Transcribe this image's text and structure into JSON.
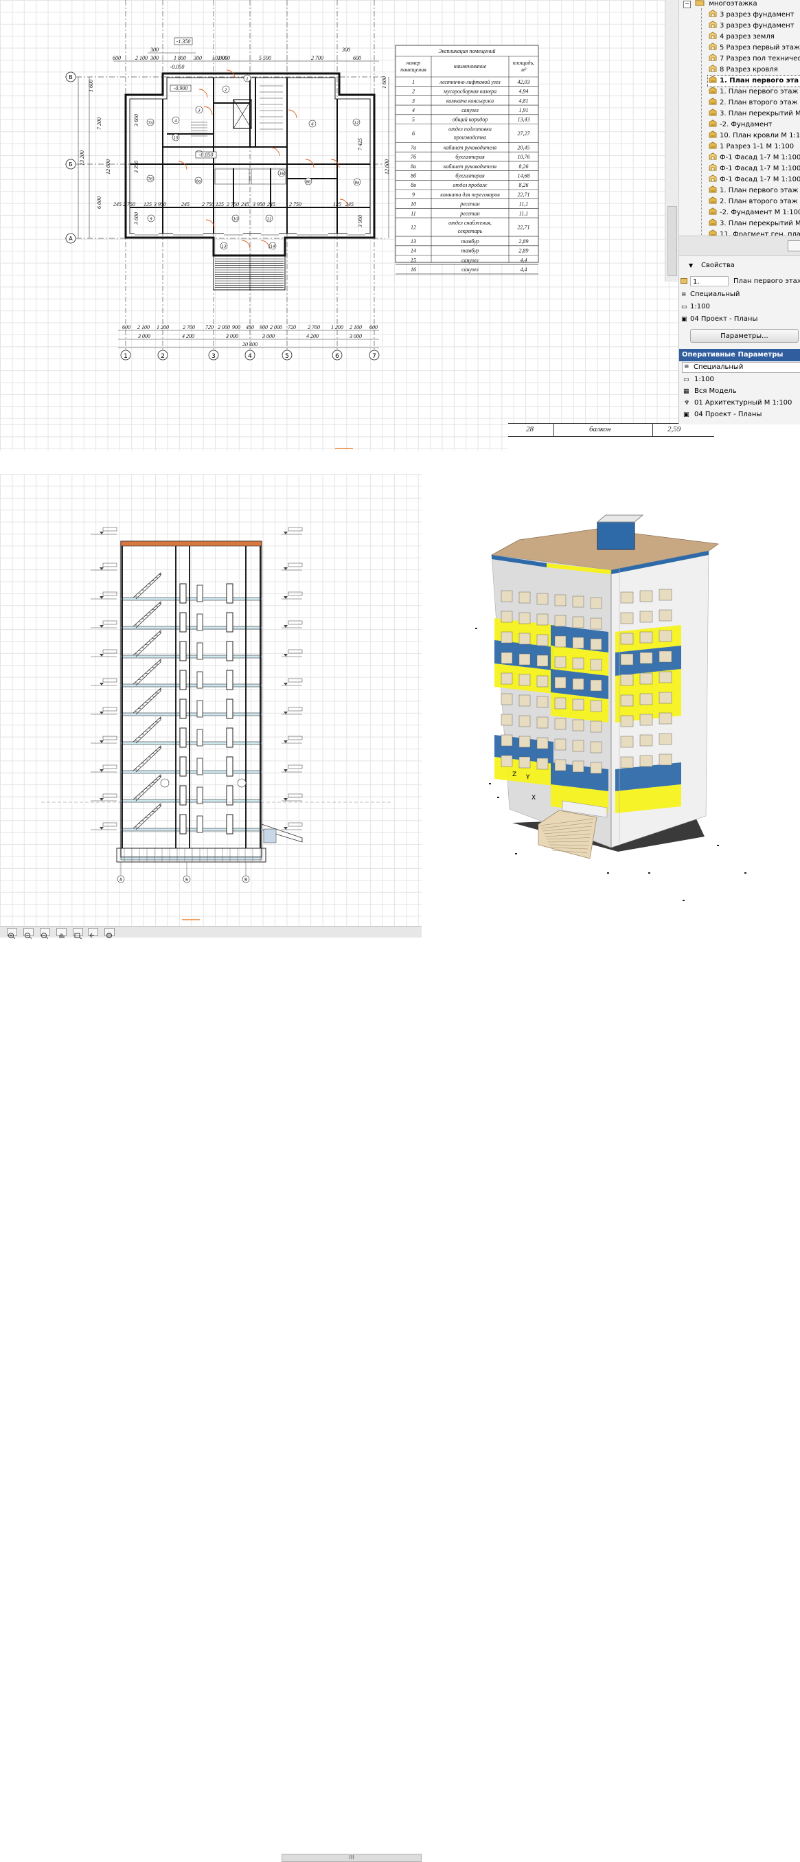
{
  "navigator": {
    "root_label": "многоэтажка",
    "items": [
      {
        "label": "3 разрез фундамент",
        "type": "section"
      },
      {
        "label": "3 разрез фундамент",
        "type": "section"
      },
      {
        "label": "4 разрез земля",
        "type": "section"
      },
      {
        "label": "5 Разрез первый этаж",
        "type": "section"
      },
      {
        "label": "7 Разрез пол техничес",
        "type": "section"
      },
      {
        "label": "8 Разрез кровля",
        "type": "section"
      },
      {
        "label": "1. План первого эта",
        "type": "layout",
        "selected": true
      },
      {
        "label": "1. План первого этаж",
        "type": "layout"
      },
      {
        "label": "2. План второго этаж",
        "type": "layout"
      },
      {
        "label": "3. План перекрытий М",
        "type": "layout"
      },
      {
        "label": "-2. Фундамент",
        "type": "layout"
      },
      {
        "label": "10. План кровли М 1:1",
        "type": "layout"
      },
      {
        "label": "1 Разрез 1-1 М 1:100",
        "type": "layout"
      },
      {
        "label": "Ф-1 Фасад 1-7 М 1:100",
        "type": "section"
      },
      {
        "label": "Ф-1 Фасад 1-7 М 1:100",
        "type": "section"
      },
      {
        "label": "Ф-1 Фасад 1-7 М 1:100",
        "type": "section"
      },
      {
        "label": "1. План первого этаж",
        "type": "layout"
      },
      {
        "label": "2. План второго этаж",
        "type": "layout"
      },
      {
        "label": "-2. Фундамент М 1:100",
        "type": "layout"
      },
      {
        "label": "3. План перекрытий М",
        "type": "layout"
      },
      {
        "label": "11. Фрагмент ген. пла",
        "type": "layout"
      }
    ]
  },
  "properties": {
    "title": "Свойства",
    "id_value": "1.",
    "name_value": "План первого этаж",
    "layer_combo": "Специальный",
    "scale": "1:100",
    "pen_set": "04 Проект - Планы",
    "settings_button": "Параметры..."
  },
  "quick_options": {
    "title": "Оперативные Параметры",
    "layer_combo": "Специальный",
    "scale": "1:100",
    "model_view": "Вся Модель",
    "structure": "01 Архитектурный М 1:100",
    "pen_set": "04 Проект - Планы"
  },
  "strip_row": {
    "num": "28",
    "name": "балкон",
    "area": "2,59"
  },
  "explication": {
    "title": "Экспликация помещений",
    "headers": [
      "номер помещения",
      "наименование",
      "площадь, м^2"
    ],
    "rows": [
      [
        "1",
        "лестнично-лифтовой узел",
        "42,03"
      ],
      [
        "2",
        "мусоросборная камера",
        "4,94"
      ],
      [
        "3",
        "комната консьержа",
        "4,81"
      ],
      [
        "4",
        "санузел",
        "1,91"
      ],
      [
        "5",
        "общий коридор",
        "13,43"
      ],
      [
        "6",
        "отдел подготовки производства",
        "27,27"
      ],
      [
        "7а",
        "кабинет руководителя",
        "20,45"
      ],
      [
        "7б",
        "бухгалтерия",
        "10,76"
      ],
      [
        "8а",
        "кабинет руководителя",
        "8,26"
      ],
      [
        "8б",
        "бухгалтерия",
        "14,68"
      ],
      [
        "8в",
        "отдел продаж",
        "8,26"
      ],
      [
        "9",
        "комната для переговоров",
        "22,71"
      ],
      [
        "10",
        "ресепшн",
        "11,1"
      ],
      [
        "11",
        "ресепшн",
        "11,1"
      ],
      [
        "12",
        "отдел снабжения, секретарь",
        "22,71"
      ],
      [
        "13",
        "тамбур",
        "2,89"
      ],
      [
        "14",
        "тамбур",
        "2,89"
      ],
      [
        "15",
        "санузел",
        "4,4"
      ],
      [
        "16",
        "санузел",
        "4,4"
      ]
    ]
  },
  "plan": {
    "axes_h": [
      "1",
      "2",
      "3",
      "4",
      "5",
      "6",
      "7"
    ],
    "axes_v": [
      "В",
      "Б",
      "А"
    ],
    "top_dims_1": [
      "600",
      "2 100",
      "300",
      "1 800",
      "300",
      "1 000",
      "5 590",
      "2 700",
      "600"
    ],
    "top_dims_2": [
      "300",
      "300"
    ],
    "top_marks": [
      "-1.350",
      "-0.050"
    ],
    "inner_marks": [
      "-0.900",
      "-0.050"
    ],
    "mid_mark": "±0.000",
    "bottom_dims_1": [
      "600",
      "2 100",
      "1 200",
      "2 700",
      "720",
      "2 000",
      "900",
      "450",
      "900",
      "2 000",
      "720",
      "2 700",
      "1 200",
      "2 100",
      "600"
    ],
    "bottom_dims_2": [
      "3 000",
      "4 200",
      "3 000",
      "3 000",
      "4 200",
      "3 000"
    ],
    "bottom_total": "20 400",
    "left_dims_outer": [
      "13 200"
    ],
    "left_dims_mid": [
      "1 600",
      "7 200",
      "12 000",
      "6 000"
    ],
    "left_dims_inner": [
      "3 600",
      "3 350",
      "3 000"
    ],
    "row_dims": [
      "245",
      "2 750",
      "125",
      "3 950",
      "245",
      "2 750",
      "125",
      "2 750",
      "245",
      "3 950",
      "245",
      "2 750",
      "125",
      "245"
    ],
    "right_dims": [
      "1 600",
      "7 425",
      "12 000",
      "3 900"
    ],
    "room_tags": [
      "1",
      "2",
      "3",
      "4",
      "5",
      "6",
      "7а",
      "7б",
      "8а",
      "8б",
      "8в",
      "9",
      "10",
      "11",
      "12",
      "13",
      "14",
      "15",
      "16"
    ]
  },
  "section_view": {
    "axis_tags": [
      "А",
      "Б",
      "В"
    ]
  },
  "model_view": {
    "axis_labels": [
      "Z",
      "Y",
      "X"
    ]
  },
  "colors": {
    "accent_blue": "#2e6aa8",
    "accent_yellow": "#f6f21e",
    "facade_white": "#dcdcdc",
    "roof": "#c8a882",
    "panel_bg": "#f3f3f3",
    "header_blue": "#2f5d9e"
  },
  "bottom_toolbar": {
    "tools": [
      "zoom-in",
      "zoom-out",
      "pan",
      "zoom-area",
      "zoom-previous",
      "fit-window"
    ],
    "scroll_label": "III"
  }
}
